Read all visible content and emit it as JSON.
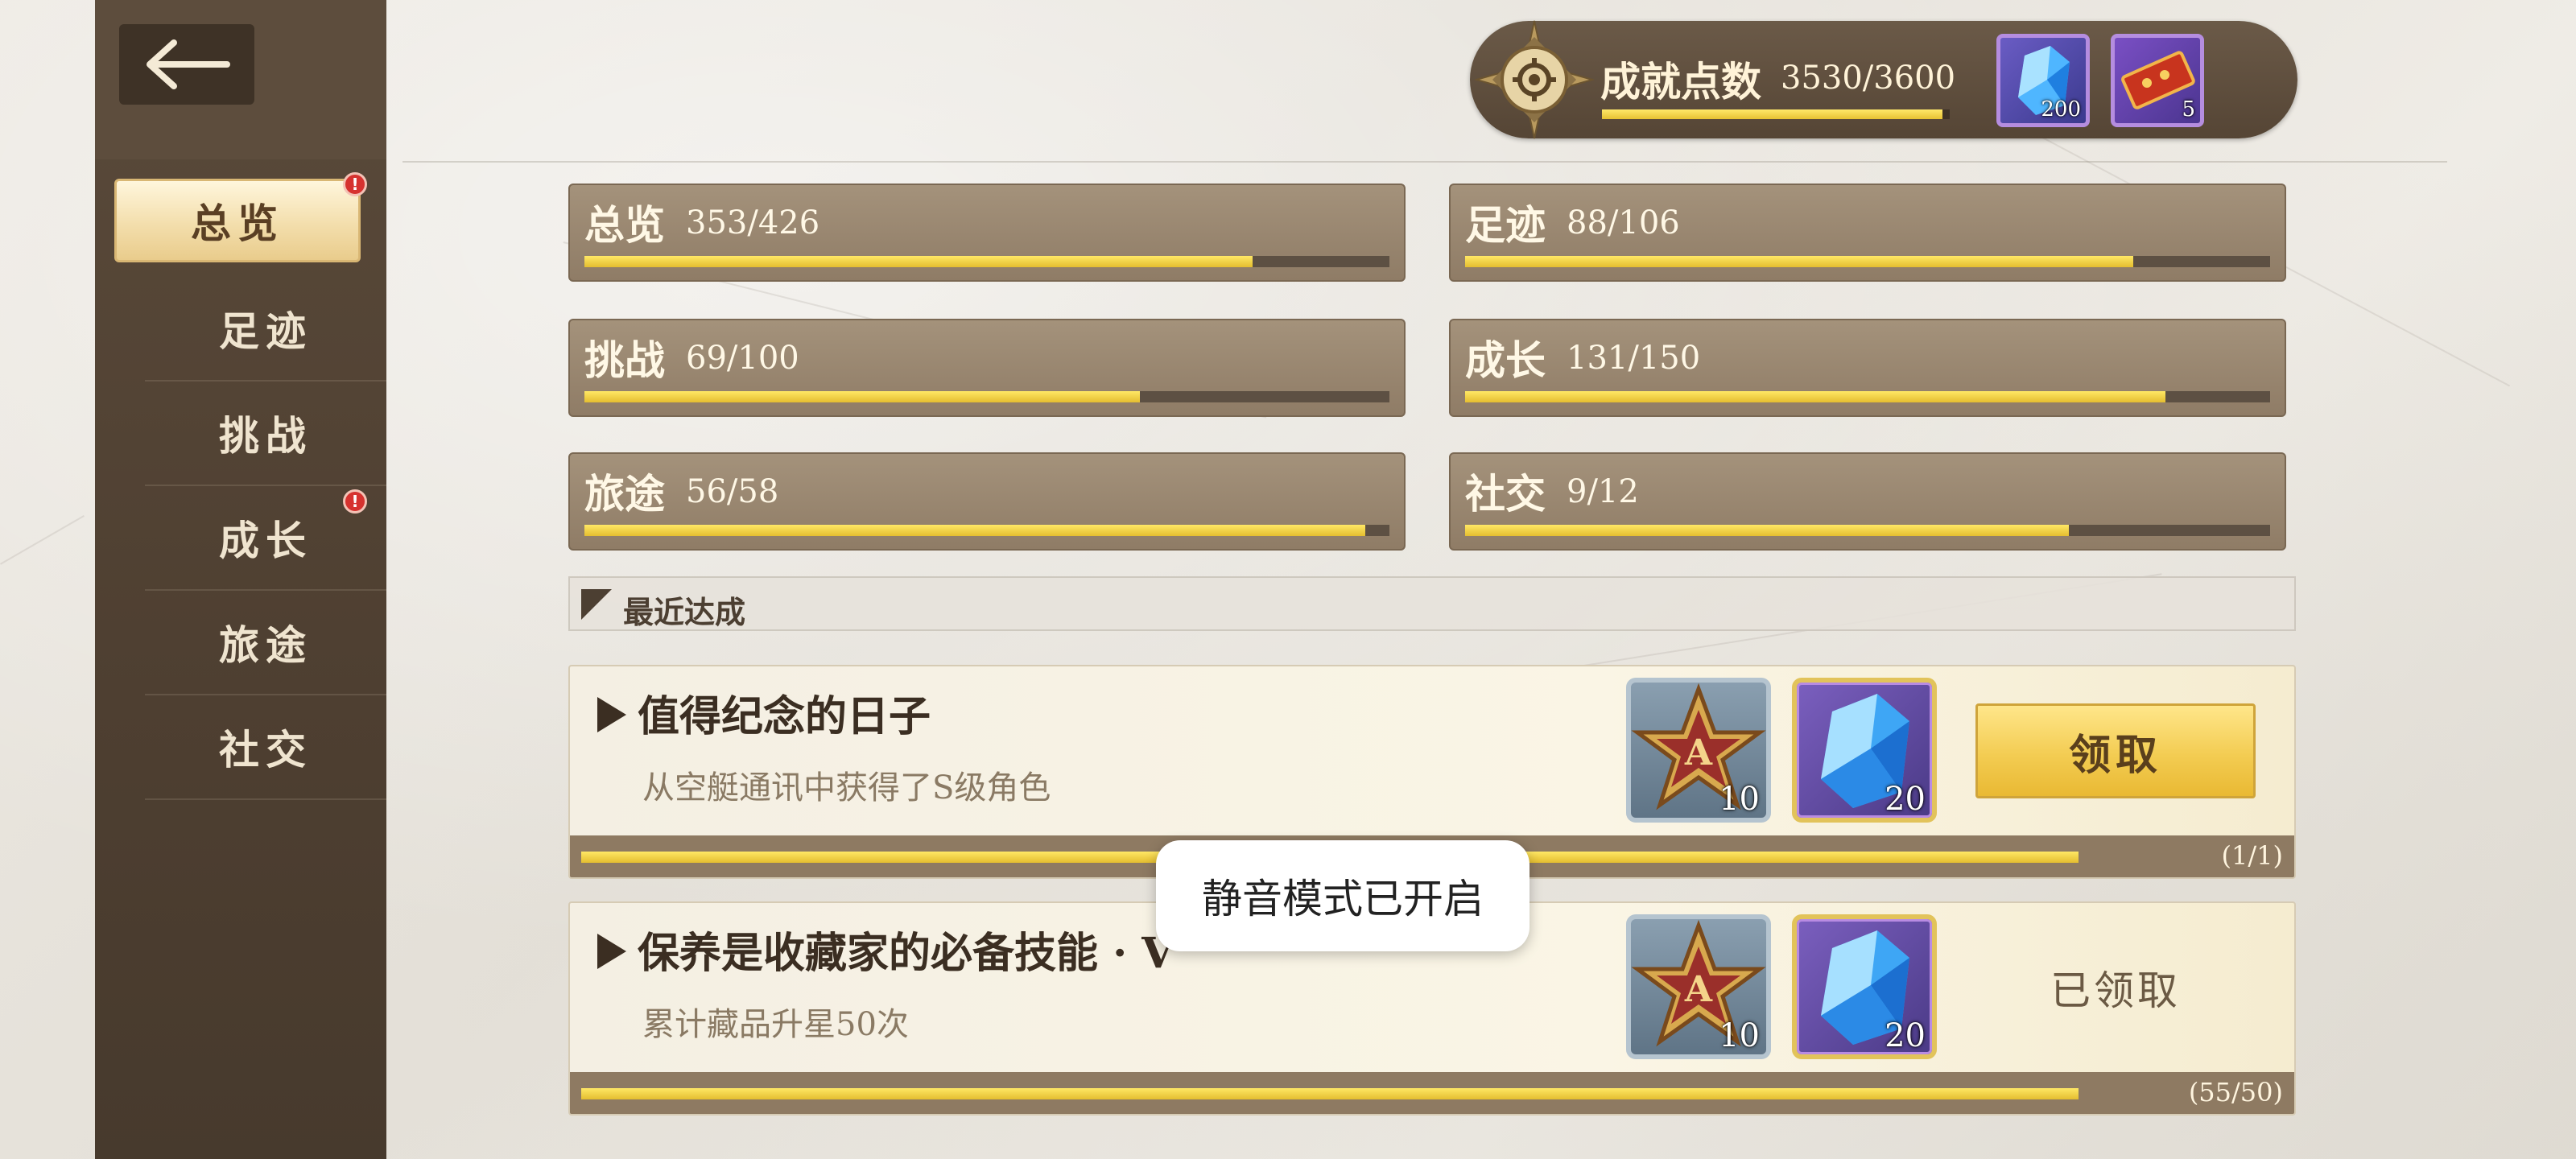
{
  "sidebar": {
    "items": [
      {
        "label": "总览",
        "active": true,
        "badge": true
      },
      {
        "label": "足迹",
        "active": false,
        "badge": false
      },
      {
        "label": "挑战",
        "active": false,
        "badge": false
      },
      {
        "label": "成长",
        "active": false,
        "badge": true
      },
      {
        "label": "旅途",
        "active": false,
        "badge": false
      },
      {
        "label": "社交",
        "active": false,
        "badge": false
      }
    ],
    "badge_text": "!"
  },
  "points": {
    "label": "成就点数",
    "value": "3530/3600",
    "progress": 0.98,
    "rewards": [
      {
        "icon": "blue-crystal-icon",
        "count": "200"
      },
      {
        "icon": "red-ticket-icon",
        "count": "5"
      }
    ]
  },
  "categories": [
    {
      "name": "总览",
      "value": "353/426",
      "progress": 0.83
    },
    {
      "name": "足迹",
      "value": "88/106",
      "progress": 0.83
    },
    {
      "name": "挑战",
      "value": "69/100",
      "progress": 0.69
    },
    {
      "name": "成长",
      "value": "131/150",
      "progress": 0.87
    },
    {
      "name": "旅途",
      "value": "56/58",
      "progress": 0.97
    },
    {
      "name": "社交",
      "value": "9/12",
      "progress": 0.75
    }
  ],
  "recent": {
    "title": "最近达成",
    "items": [
      {
        "title": "值得纪念的日子",
        "desc": "从空艇通讯中获得了S级角色",
        "rewards": [
          {
            "icon": "a-rank-star-icon",
            "count": "10"
          },
          {
            "icon": "blue-crystal-icon",
            "count": "20"
          }
        ],
        "action": "领取",
        "progress_text": "(1/1)",
        "progress": 1.0
      },
      {
        "title": "保养是收藏家的必备技能 · V",
        "desc": "累计藏品升星50次",
        "rewards": [
          {
            "icon": "a-rank-star-icon",
            "count": "10"
          },
          {
            "icon": "blue-crystal-icon",
            "count": "20"
          }
        ],
        "action": "已领取",
        "progress_text": "(55/50)",
        "progress": 1.0
      }
    ]
  },
  "toast": {
    "text": "静音模式已开启"
  },
  "colors": {
    "accent_gold": "#f3cc52",
    "sidebar_brown": "#4e3f31",
    "badge_red": "#d6322f",
    "bar_yellow": "#e4bd2f"
  }
}
